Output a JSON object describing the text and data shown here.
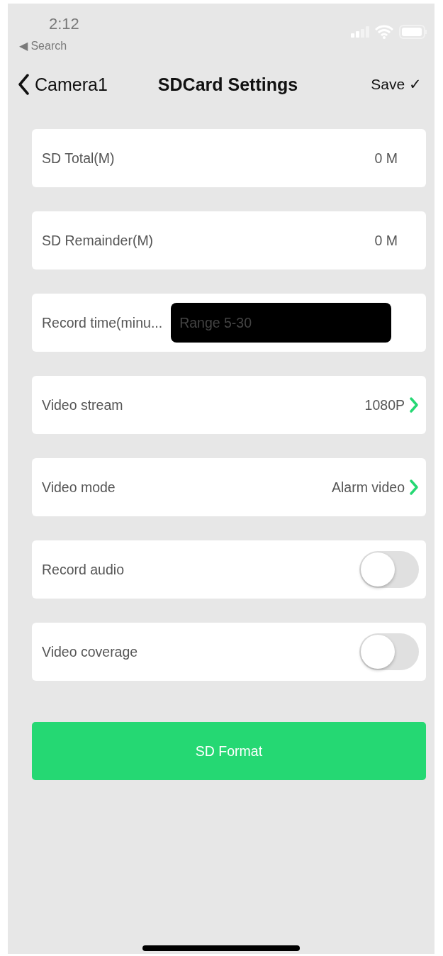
{
  "status_bar": {
    "time": "2:12",
    "back_link": "◀ Search"
  },
  "nav": {
    "back": "Camera1",
    "title": "SDCard Settings",
    "save": "Save ✓"
  },
  "rows": [
    {
      "kind": "value",
      "label": "SD Total(M)",
      "value": "0 M"
    },
    {
      "kind": "value",
      "label": "SD Remainder(M)",
      "value": "0 M"
    },
    {
      "kind": "input",
      "label": "Record time(minu...",
      "placeholder": "Range 5-30"
    },
    {
      "kind": "select",
      "label": "Video stream",
      "value": "1080P"
    },
    {
      "kind": "select",
      "label": "Video mode",
      "value": "Alarm video"
    },
    {
      "kind": "toggle",
      "label": "Record audio",
      "on": false
    },
    {
      "kind": "toggle",
      "label": "Video coverage",
      "on": false
    }
  ],
  "format_button": "SD Format"
}
